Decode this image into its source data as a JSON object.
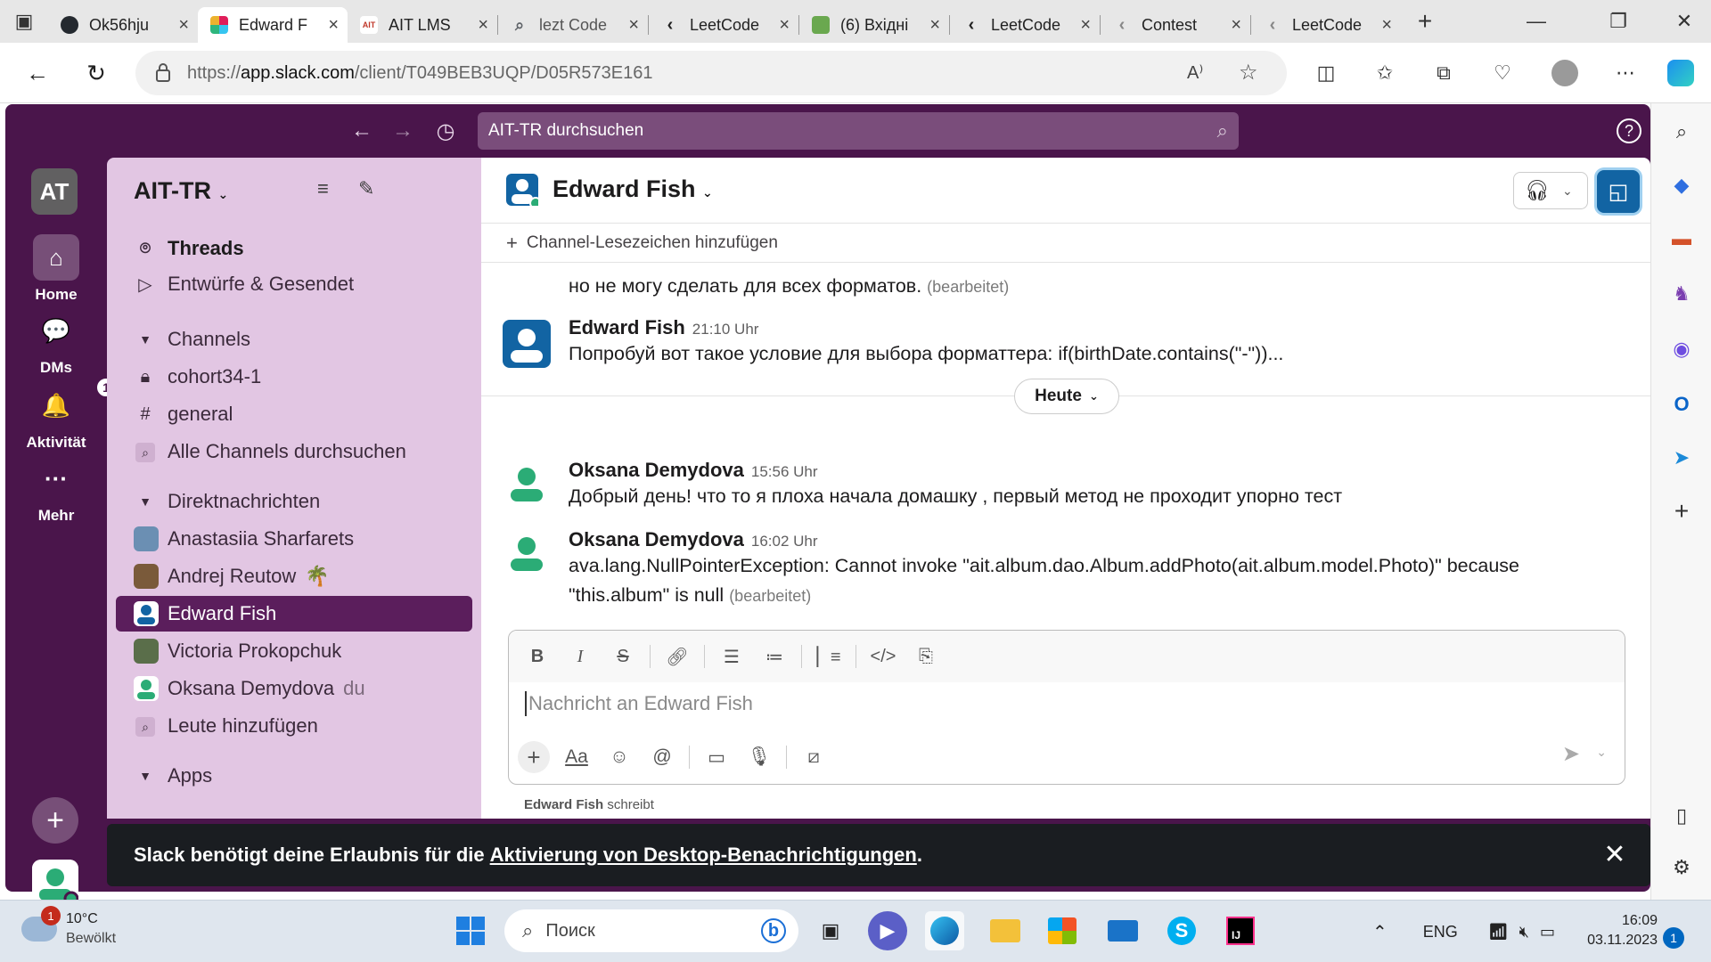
{
  "browser": {
    "tabs": [
      {
        "title": "Ok56hju",
        "favicon_color": "#24292f"
      },
      {
        "title": "Edward F",
        "favicon_color": "#e01e5a",
        "active": true
      },
      {
        "title": "AIT LMS",
        "favicon_color": "#c0392b",
        "favicon_text": "AIT"
      },
      {
        "title": "lezt Code",
        "favicon_color": "#5f6368"
      },
      {
        "title": "LeetCode",
        "favicon_color": "#ffa116"
      },
      {
        "title": "(6) Вхідні",
        "favicon_color": "#6aa84f"
      },
      {
        "title": "LeetCode",
        "favicon_color": "#ffa116"
      },
      {
        "title": "Contest",
        "favicon_color": "#ffa116"
      },
      {
        "title": "LeetCode",
        "favicon_color": "#ffa116"
      }
    ],
    "url_prefix": "https://",
    "url_host": "app.slack.com",
    "url_path": "/client/T049BEB3UQP/D05R573E161"
  },
  "slack": {
    "search_placeholder": "AIT-TR durchsuchen",
    "workspace_badge": "AT",
    "workspace_name": "AIT-TR",
    "rail": {
      "home": "Home",
      "dms": "DMs",
      "activity": "Aktivität",
      "activity_count": "1",
      "more": "Mehr"
    },
    "sidebar": {
      "threads": "Threads",
      "drafts": "Entwürfe & Gesendet",
      "channels_header": "Channels",
      "channels": [
        "cohort34-1",
        "general"
      ],
      "browse_channels": "Alle Channels durchsuchen",
      "dm_header": "Direktnachrichten",
      "dms": [
        {
          "name": "Anastasiia Sharfarets",
          "color": "#6b8fb3"
        },
        {
          "name": "Andrej Reutow",
          "color": "#7a5a3a",
          "emoji": "🌴"
        },
        {
          "name": "Edward Fish",
          "color": "#1264a3",
          "selected": true
        },
        {
          "name": "Victoria Prokopchuk",
          "color": "#5a6e4a"
        },
        {
          "name": "Oksana Demydova",
          "color": "#2bac76",
          "suffix": "du"
        }
      ],
      "add_people": "Leute hinzufügen",
      "apps_header": "Apps"
    },
    "channel": {
      "title": "Edward Fish",
      "add_bookmark": "Channel-Lesezeichen hinzufügen"
    },
    "messages": {
      "prev_line": "но не могу сделать для всех форматов.",
      "prev_edited": "(bearbeitet)",
      "m1": {
        "author": "Edward Fish",
        "time": "21:10 Uhr",
        "text": "Попробуй вот такое условие для выбора форматтера: if(birthDate.contains(\"-\"))..."
      },
      "day_label": "Heute",
      "m2": {
        "author": "Oksana Demydova",
        "time": "15:56 Uhr",
        "text": "Добрый день! что то я плоха начала домашку , первый метод не проходит упорно тест"
      },
      "m3": {
        "author": "Oksana Demydova",
        "time": "16:02 Uhr",
        "text_line1": "ava.lang.NullPointerException: Cannot invoke \"ait.album.dao.Album.addPhoto(ait.album.model.Photo)\" because",
        "text_line2": "\"this.album\" is null",
        "edited": "(bearbeitet)"
      }
    },
    "composer": {
      "placeholder": "Nachricht an Edward Fish",
      "typing_name": "Edward Fish",
      "typing_suffix": "schreibt"
    },
    "notification": {
      "prefix": "Slack benötigt deine Erlaubnis für die",
      "link": "Aktivierung von Desktop-Benachrichtigungen",
      "suffix": "."
    }
  },
  "taskbar": {
    "weather_temp": "10°C",
    "weather_desc": "Bewölkt",
    "weather_badge": "1",
    "search_placeholder": "Поиск",
    "lang": "ENG",
    "time": "16:09",
    "date": "03.11.2023",
    "notif_count": "1"
  }
}
